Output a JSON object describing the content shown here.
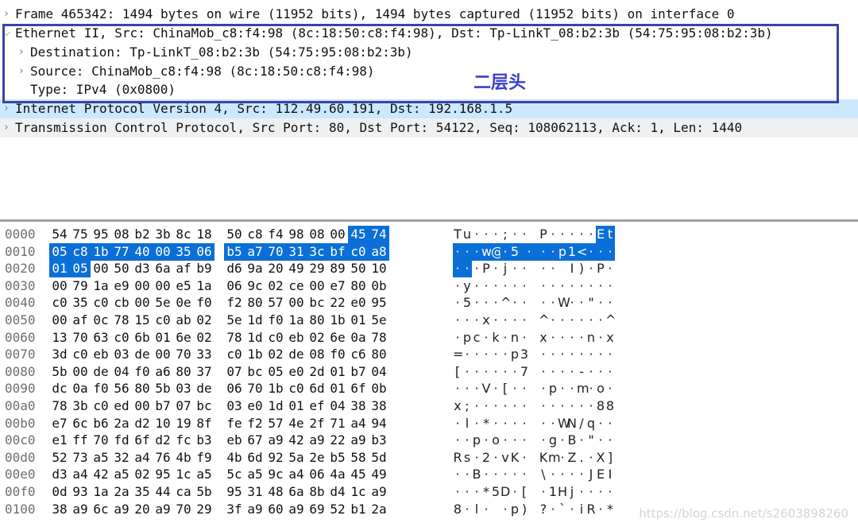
{
  "colors": {
    "selected_row": "#cce8ff",
    "highlight": "#0a6fd6",
    "annotation_box": "#3b43a8",
    "annotation_text": "#3a3fd0"
  },
  "tree": [
    {
      "label": "Frame 465342: 1494 bytes on wire (11952 bits), 1494 bytes captured (11952 bits) on interface 0",
      "level": 0,
      "expander": "collapsed",
      "state": "normal"
    },
    {
      "label": "Ethernet II, Src: ChinaMob_c8:f4:98 (8c:18:50:c8:f4:98), Dst: Tp-LinkT_08:b2:3b (54:75:95:08:b2:3b)",
      "level": 0,
      "expander": "expanded",
      "state": "normal"
    },
    {
      "label": "Destination: Tp-LinkT_08:b2:3b (54:75:95:08:b2:3b)",
      "level": 1,
      "expander": "collapsed",
      "state": "normal"
    },
    {
      "label": "Source: ChinaMob_c8:f4:98 (8c:18:50:c8:f4:98)",
      "level": 1,
      "expander": "collapsed",
      "state": "normal"
    },
    {
      "label": "Type: IPv4 (0x0800)",
      "level": 1,
      "expander": "none",
      "state": "normal"
    },
    {
      "label": "Internet Protocol Version 4, Src: 112.49.60.191, Dst: 192.168.1.5",
      "level": 0,
      "expander": "collapsed",
      "state": "selected"
    },
    {
      "label": "Transmission Control Protocol, Src Port: 80, Dst Port: 54122, Seq: 108062113, Ack: 1, Len: 1440",
      "level": 0,
      "expander": "collapsed",
      "state": "alt"
    }
  ],
  "annotation": {
    "text": "二层头"
  },
  "hexdump": [
    {
      "offset": "0000",
      "bytes": [
        "54",
        "75",
        "95",
        "08",
        "b2",
        "3b",
        "8c",
        "18",
        "50",
        "c8",
        "f4",
        "98",
        "08",
        "00",
        "45",
        "74"
      ],
      "ascii": [
        "T",
        "u",
        "·",
        "·",
        "·",
        ";",
        "·",
        "·",
        "P",
        "·",
        "·",
        "·",
        "·",
        "·",
        "E",
        "t"
      ],
      "hl": [
        14,
        15
      ]
    },
    {
      "offset": "0010",
      "bytes": [
        "05",
        "c8",
        "1b",
        "77",
        "40",
        "00",
        "35",
        "06",
        "b5",
        "a7",
        "70",
        "31",
        "3c",
        "bf",
        "c0",
        "a8"
      ],
      "ascii": [
        "·",
        "·",
        "·",
        "w",
        "@",
        "·",
        "5",
        "·",
        "·",
        "·",
        "p",
        "1",
        "<",
        "·",
        "·",
        "·"
      ],
      "hl": [
        0,
        1,
        2,
        3,
        4,
        5,
        6,
        7,
        8,
        9,
        10,
        11,
        12,
        13,
        14,
        15
      ]
    },
    {
      "offset": "0020",
      "bytes": [
        "01",
        "05",
        "00",
        "50",
        "d3",
        "6a",
        "af",
        "b9",
        "d6",
        "9a",
        "20",
        "49",
        "29",
        "89",
        "50",
        "10"
      ],
      "ascii": [
        "·",
        "·",
        "·",
        "P",
        "·",
        "j",
        "·",
        "·",
        "·",
        "·",
        " ",
        "I",
        ")",
        "·",
        "P",
        "·"
      ],
      "hl": [
        0,
        1
      ]
    },
    {
      "offset": "0030",
      "bytes": [
        "00",
        "79",
        "1a",
        "e9",
        "00",
        "00",
        "e5",
        "1a",
        "06",
        "9c",
        "02",
        "ce",
        "00",
        "e7",
        "80",
        "0b"
      ],
      "ascii": [
        "·",
        "y",
        "·",
        "·",
        "·",
        "·",
        "·",
        "·",
        "·",
        "·",
        "·",
        "·",
        "·",
        "·",
        "·",
        "·"
      ],
      "hl": []
    },
    {
      "offset": "0040",
      "bytes": [
        "c0",
        "35",
        "c0",
        "cb",
        "00",
        "5e",
        "0e",
        "f0",
        "f2",
        "80",
        "57",
        "00",
        "bc",
        "22",
        "e0",
        "95"
      ],
      "ascii": [
        "·",
        "5",
        "·",
        "·",
        "·",
        "^",
        "·",
        "·",
        "·",
        "·",
        "W",
        "·",
        "·",
        "\"",
        "·",
        "·"
      ],
      "hl": []
    },
    {
      "offset": "0050",
      "bytes": [
        "00",
        "af",
        "0c",
        "78",
        "15",
        "c0",
        "ab",
        "02",
        "5e",
        "1d",
        "f0",
        "1a",
        "80",
        "1b",
        "01",
        "5e"
      ],
      "ascii": [
        "·",
        "·",
        "·",
        "x",
        "·",
        "·",
        "·",
        "·",
        "^",
        "·",
        "·",
        "·",
        "·",
        "·",
        "·",
        "^"
      ],
      "hl": []
    },
    {
      "offset": "0060",
      "bytes": [
        "13",
        "70",
        "63",
        "c0",
        "6b",
        "01",
        "6e",
        "02",
        "78",
        "1d",
        "c0",
        "eb",
        "02",
        "6e",
        "0a",
        "78"
      ],
      "ascii": [
        "·",
        "p",
        "c",
        "·",
        "k",
        "·",
        "n",
        "·",
        "x",
        "·",
        "·",
        "·",
        "·",
        "n",
        "·",
        "x"
      ],
      "hl": []
    },
    {
      "offset": "0070",
      "bytes": [
        "3d",
        "c0",
        "eb",
        "03",
        "de",
        "00",
        "70",
        "33",
        "c0",
        "1b",
        "02",
        "de",
        "08",
        "f0",
        "c6",
        "80"
      ],
      "ascii": [
        "=",
        "·",
        "·",
        "·",
        "·",
        "·",
        "p",
        "3",
        "·",
        "·",
        "·",
        "·",
        "·",
        "·",
        "·",
        "·"
      ],
      "hl": []
    },
    {
      "offset": "0080",
      "bytes": [
        "5b",
        "00",
        "de",
        "04",
        "f0",
        "a6",
        "80",
        "37",
        "07",
        "bc",
        "05",
        "e0",
        "2d",
        "01",
        "b7",
        "04"
      ],
      "ascii": [
        "[",
        "·",
        "·",
        "·",
        "·",
        "·",
        "·",
        "7",
        "·",
        "·",
        "·",
        "·",
        "-",
        "·",
        "·",
        "·"
      ],
      "hl": []
    },
    {
      "offset": "0090",
      "bytes": [
        "dc",
        "0a",
        "f0",
        "56",
        "80",
        "5b",
        "03",
        "de",
        "06",
        "70",
        "1b",
        "c0",
        "6d",
        "01",
        "6f",
        "0b"
      ],
      "ascii": [
        "·",
        "·",
        "·",
        "V",
        "·",
        "[",
        "·",
        "·",
        "·",
        "p",
        "·",
        "·",
        "m",
        "·",
        "o",
        "·"
      ],
      "hl": []
    },
    {
      "offset": "00a0",
      "bytes": [
        "78",
        "3b",
        "c0",
        "ed",
        "00",
        "b7",
        "07",
        "bc",
        "03",
        "e0",
        "1d",
        "01",
        "ef",
        "04",
        "38",
        "38"
      ],
      "ascii": [
        "x",
        ";",
        "·",
        "·",
        "·",
        "·",
        "·",
        "·",
        "·",
        "·",
        "·",
        "·",
        "·",
        "·",
        "8",
        "8"
      ],
      "hl": []
    },
    {
      "offset": "00b0",
      "bytes": [
        "e7",
        "6c",
        "b6",
        "2a",
        "d2",
        "10",
        "19",
        "8f",
        "fe",
        "f2",
        "57",
        "4e",
        "2f",
        "71",
        "a4",
        "94"
      ],
      "ascii": [
        "·",
        "l",
        "·",
        "*",
        "·",
        "·",
        "·",
        "·",
        "·",
        "·",
        "W",
        "N",
        "/",
        "q",
        "·",
        "·"
      ],
      "hl": []
    },
    {
      "offset": "00c0",
      "bytes": [
        "e1",
        "ff",
        "70",
        "fd",
        "6f",
        "d2",
        "fc",
        "b3",
        "eb",
        "67",
        "a9",
        "42",
        "a9",
        "22",
        "a9",
        "b3"
      ],
      "ascii": [
        "·",
        "·",
        "p",
        "·",
        "o",
        "·",
        "·",
        "·",
        "·",
        "g",
        "·",
        "B",
        "·",
        "\"",
        "·",
        "·"
      ],
      "hl": []
    },
    {
      "offset": "00d0",
      "bytes": [
        "52",
        "73",
        "a5",
        "32",
        "a4",
        "76",
        "4b",
        "f9",
        "4b",
        "6d",
        "92",
        "5a",
        "2e",
        "b5",
        "58",
        "5d"
      ],
      "ascii": [
        "R",
        "s",
        "·",
        "2",
        "·",
        "v",
        "K",
        "·",
        "K",
        "m",
        "·",
        "Z",
        ".",
        "·",
        "X",
        "]"
      ],
      "hl": []
    },
    {
      "offset": "00e0",
      "bytes": [
        "d3",
        "a4",
        "42",
        "a5",
        "02",
        "95",
        "1c",
        "a5",
        "5c",
        "a5",
        "9c",
        "a4",
        "06",
        "4a",
        "45",
        "49"
      ],
      "ascii": [
        "·",
        "·",
        "B",
        "·",
        "·",
        "·",
        "·",
        "·",
        "\\",
        "·",
        "·",
        "·",
        "·",
        "J",
        "E",
        "I"
      ],
      "hl": []
    },
    {
      "offset": "00f0",
      "bytes": [
        "0d",
        "93",
        "1a",
        "2a",
        "35",
        "44",
        "ca",
        "5b",
        "95",
        "31",
        "48",
        "6a",
        "8b",
        "d4",
        "1c",
        "a9"
      ],
      "ascii": [
        "·",
        "·",
        "·",
        "*",
        "5",
        "D",
        "·",
        "[",
        "·",
        "1",
        "H",
        "j",
        "·",
        "·",
        "·",
        "·"
      ],
      "hl": []
    },
    {
      "offset": "0100",
      "bytes": [
        "38",
        "a9",
        "6c",
        "a9",
        "20",
        "a9",
        "70",
        "29",
        "3f",
        "a9",
        "60",
        "a9",
        "69",
        "52",
        "b1",
        "2a"
      ],
      "ascii": [
        "8",
        "·",
        "l",
        "·",
        " ",
        "·",
        "p",
        ")",
        "?",
        "·",
        "`",
        "·",
        "i",
        "R",
        "·",
        "*"
      ],
      "hl": []
    }
  ],
  "watermark": "https://blog.csdn.net/s2603898260"
}
